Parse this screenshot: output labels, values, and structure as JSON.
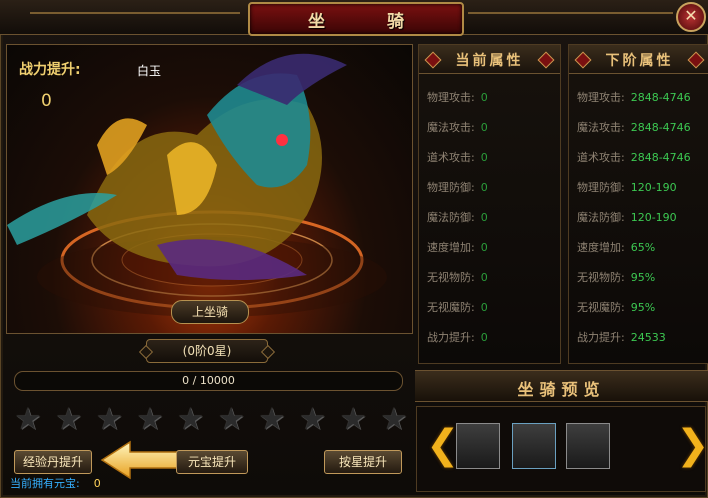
{
  "window": {
    "title": "坐 骑",
    "close_label": "✕"
  },
  "stage": {
    "power_label": "战力提升:",
    "power_value": "0",
    "mount_name": "白玉",
    "ride_button": "上坐骑"
  },
  "rank": {
    "label": "(0阶0星)"
  },
  "progress": {
    "text": "0 / 10000",
    "fraction": 0.0
  },
  "stars": {
    "count": 10,
    "filled": 0,
    "glyph": "★"
  },
  "buttons": {
    "exp_pill": "经验丹提升",
    "ingot": "元宝提升",
    "by_star": "按星提升"
  },
  "currency": {
    "label": "当前拥有元宝:",
    "value": "0"
  },
  "current_attrs": {
    "title": "当前属性",
    "rows": [
      {
        "name": "物理攻击:",
        "value": "0"
      },
      {
        "name": "魔法攻击:",
        "value": "0"
      },
      {
        "name": "道术攻击:",
        "value": "0"
      },
      {
        "name": "物理防御:",
        "value": "0"
      },
      {
        "name": "魔法防御:",
        "value": "0"
      },
      {
        "name": "速度增加:",
        "value": "0"
      },
      {
        "name": "无视物防:",
        "value": "0"
      },
      {
        "name": "无视魔防:",
        "value": "0"
      },
      {
        "name": "战力提升:",
        "value": "0"
      }
    ]
  },
  "next_attrs": {
    "title": "下阶属性",
    "rows": [
      {
        "name": "物理攻击:",
        "value": "2848-4746"
      },
      {
        "name": "魔法攻击:",
        "value": "2848-4746"
      },
      {
        "name": "道术攻击:",
        "value": "2848-4746"
      },
      {
        "name": "物理防御:",
        "value": "120-190"
      },
      {
        "name": "魔法防御:",
        "value": "120-190"
      },
      {
        "name": "速度增加:",
        "value": "65%"
      },
      {
        "name": "无视物防:",
        "value": "95%"
      },
      {
        "name": "无视魔防:",
        "value": "95%"
      },
      {
        "name": "战力提升:",
        "value": "24533"
      }
    ]
  },
  "preview": {
    "title": "坐骑预览",
    "prev_label": "❮",
    "next_label": "❯"
  },
  "colors": {
    "gold": "#e9c17a",
    "green": "#3cc852",
    "blue": "#35b0ff"
  }
}
